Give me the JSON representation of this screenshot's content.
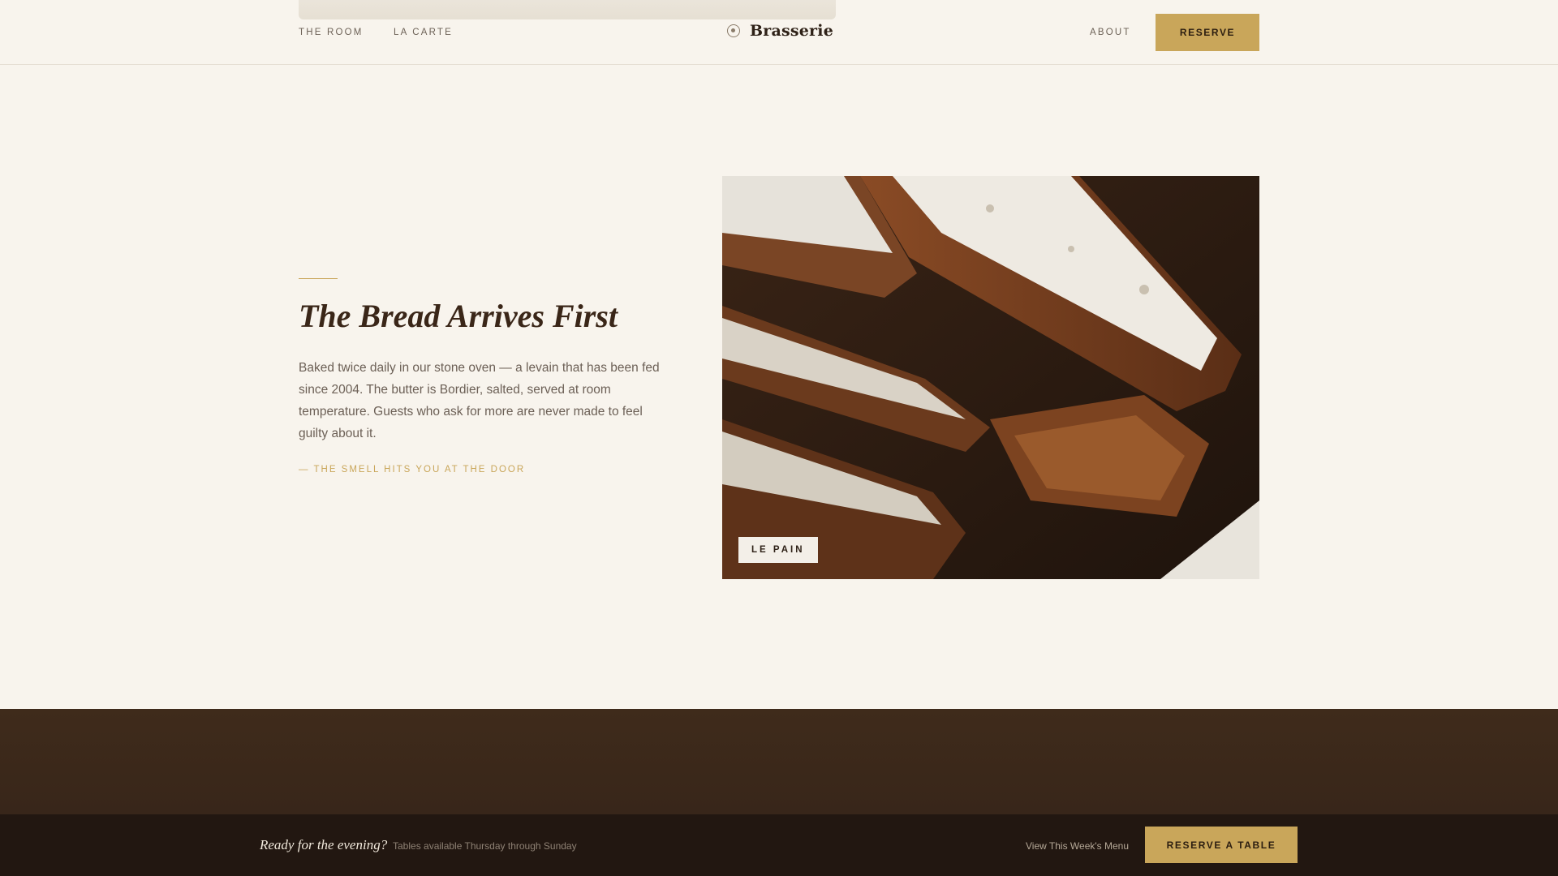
{
  "header": {
    "nav_left": [
      "THE ROOM",
      "LA CARTE"
    ],
    "brand": "Brasserie",
    "nav_right": "ABOUT",
    "reserve_label": "RESERVE"
  },
  "feature": {
    "title": "The Bread Arrives First",
    "body": "Baked twice daily in our stone oven — a levain that has been fed since 2004. The butter is Bordier, salted, served at room temperature. Guests who ask for more are never made to feel guilty about it.",
    "tagline": "— THE SMELL HITS YOU AT THE DOOR",
    "image_label": "LE PAIN"
  },
  "footer": {
    "title": "Ready for the evening?",
    "subtitle": "Tables available Thursday through Sunday",
    "menu_link": "View This Week's Menu",
    "cta_label": "RESERVE A TABLE"
  },
  "colors": {
    "background": "#f8f4ed",
    "accent": "#c9a65a",
    "dark_band": "#3f2b1b",
    "footer": "#221711"
  }
}
